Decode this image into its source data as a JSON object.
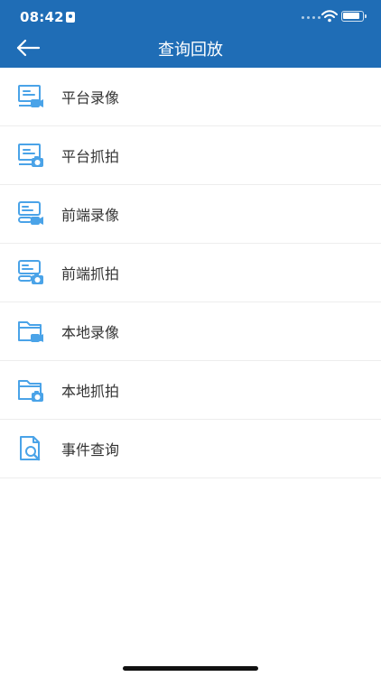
{
  "status_bar": {
    "time": "08:42"
  },
  "header": {
    "title": "查询回放",
    "background": "#1f6db6"
  },
  "menu": {
    "items": [
      {
        "label": "平台录像",
        "icon": "platform-video-icon"
      },
      {
        "label": "平台抓拍",
        "icon": "platform-snapshot-icon"
      },
      {
        "label": "前端录像",
        "icon": "frontend-video-icon"
      },
      {
        "label": "前端抓拍",
        "icon": "frontend-snapshot-icon"
      },
      {
        "label": "本地录像",
        "icon": "local-video-icon"
      },
      {
        "label": "本地抓拍",
        "icon": "local-snapshot-icon"
      },
      {
        "label": "事件查询",
        "icon": "event-search-icon"
      }
    ]
  },
  "colors": {
    "icon_blue": "#4aa3e8",
    "text": "#333333",
    "divider": "#ededed"
  }
}
